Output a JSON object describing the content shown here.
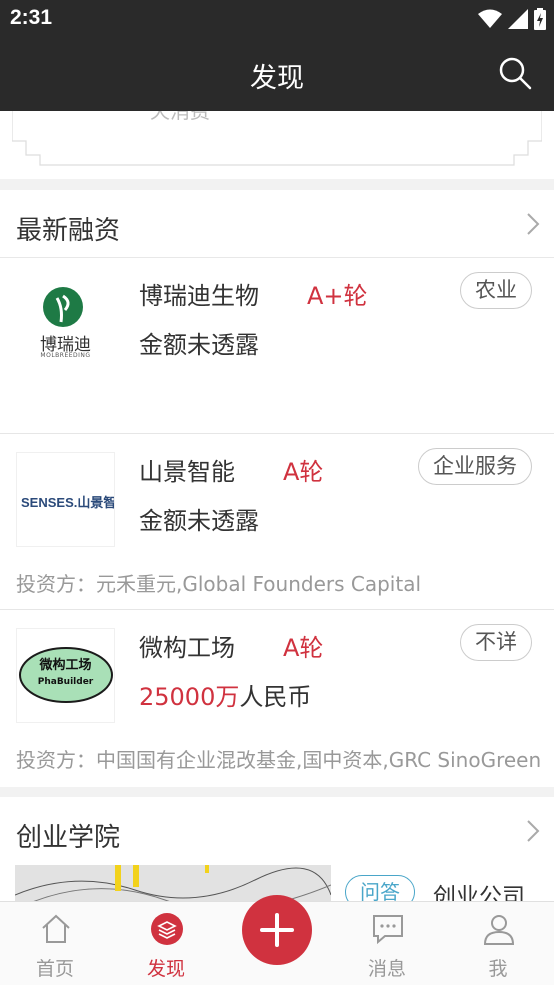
{
  "status": {
    "time": "2:31"
  },
  "header": {
    "title": "发现"
  },
  "banner": {
    "partial_text": "天消费"
  },
  "funding": {
    "section_label": "最新融资",
    "items": [
      {
        "name": "博瑞迪生物",
        "round": "A+轮",
        "tag": "农业",
        "amount": "金额未透露",
        "investors": "",
        "logo_text": "博瑞迪",
        "logo_sub": "MOLBREEDING"
      },
      {
        "name": "山景智能",
        "round": "A轮",
        "tag": "企业服务",
        "amount": "金额未透露",
        "investors": "投资方：元禾重元,Global Founders Capital",
        "logo_text": "SENSES.山景智能"
      },
      {
        "name": "微构工场",
        "round": "A轮",
        "tag": "不详",
        "amount_value": "25000万",
        "amount_unit": "人民币",
        "investors": "投资方：中国国有企业混改基金,国中资本,GRC SinoGreen",
        "logo_text": "微构工场",
        "logo_sub": "PhaBuilder"
      }
    ]
  },
  "academy": {
    "section_label": "创业学院",
    "tag": "问答",
    "title_partial": "创业公司"
  },
  "tabs": [
    {
      "label": "首页",
      "icon": "home-icon"
    },
    {
      "label": "发现",
      "icon": "layers-icon"
    },
    {
      "label": "",
      "icon": "plus-icon"
    },
    {
      "label": "消息",
      "icon": "chat-icon"
    },
    {
      "label": "我",
      "icon": "user-icon"
    }
  ],
  "colors": {
    "accent": "#d0323f",
    "bar": "#2a2a2a"
  }
}
